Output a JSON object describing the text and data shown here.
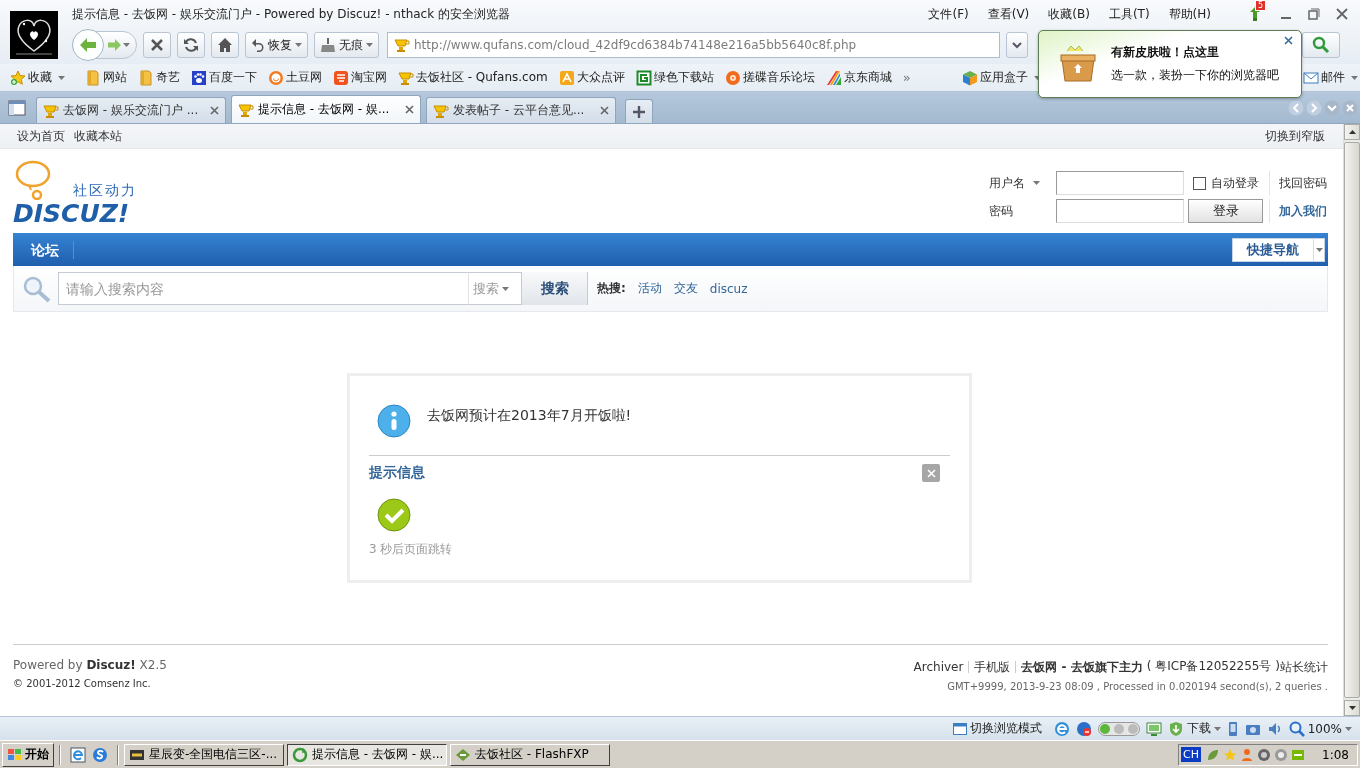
{
  "window": {
    "title": "提示信息 - 去饭网 - 娱乐交流门户 - Powered by Discuz! - nthack 的安全浏览器"
  },
  "menu": [
    "文件(F)",
    "查看(V)",
    "收藏(B)",
    "工具(T)",
    "帮助(H)"
  ],
  "notification_badge": "5",
  "toolbar": {
    "restore": "恢复",
    "private": "无痕"
  },
  "address_bar": {
    "url": "http://www.qufans.com/cloud_42df9cd6384b74148e216a5bb5640c8f.php"
  },
  "bookmarks": [
    {
      "label": "收藏",
      "kind": "star"
    },
    {
      "label": "网站",
      "kind": "folder"
    },
    {
      "label": "奇艺",
      "kind": "folder"
    },
    {
      "label": "百度一下",
      "kind": "paw"
    },
    {
      "label": "土豆网",
      "kind": "face"
    },
    {
      "label": "淘宝网",
      "kind": "tao"
    },
    {
      "label": "去饭社区 - Qufans.com",
      "kind": "cup"
    },
    {
      "label": "大众点评",
      "kind": "review"
    },
    {
      "label": "绿色下载站",
      "kind": "gbox"
    },
    {
      "label": "搓碟音乐论坛",
      "kind": "disc"
    },
    {
      "label": "京东商城",
      "kind": "rainbow"
    },
    {
      "label": "»",
      "kind": "more"
    },
    {
      "label": "应用盒子",
      "kind": "cube"
    },
    {
      "label": "邮件",
      "kind": "mail"
    }
  ],
  "tabs": [
    {
      "title": "去饭网 - 娱乐交流门户 ...",
      "selected": false
    },
    {
      "title": "提示信息 - 去饭网 - 娱...",
      "selected": true
    },
    {
      "title": "发表帖子 - 云平台意见...",
      "selected": false
    }
  ],
  "popup": {
    "title": "有新皮肤啦！点这里",
    "text": "选一款，装扮一下你的浏览器吧"
  },
  "site_topbar": {
    "links": [
      "设为首页",
      "收藏本站"
    ],
    "switch_width": "切换到窄版"
  },
  "logo": {
    "tagline": "社区动力",
    "wordmark": "DISCUZ!"
  },
  "login": {
    "username_label": "用户名",
    "password_label": "密码",
    "auto_login": {
      "label": "自动登录",
      "checked": false
    },
    "button": "登录",
    "forgot": "找回密码",
    "register": "加入我们"
  },
  "nav": {
    "items": [
      "论坛"
    ],
    "quick_nav": "快捷导航"
  },
  "search": {
    "placeholder": "请输入搜索内容",
    "scope": "搜索",
    "button": "搜索",
    "hot_label": "热搜:",
    "hot": [
      "活动",
      "交友",
      "discuz"
    ]
  },
  "message": {
    "text": "去饭网预计在2013年7月开饭啦!",
    "title": "提示信息",
    "redirect": "3 秒后页面跳转"
  },
  "footer": {
    "powered": "Powered by **Discuz!** X2.5",
    "copyright": "© 2001-2012 Comsenz Inc.",
    "links": [
      "Archiver",
      "手机版"
    ],
    "site": "去饭网 - 去饭旗下主力",
    "icp": "( 粤ICP备12052255号 )",
    "stats": "站长统计",
    "debug": "GMT+9999, 2013-9-23 08:09 , Processed in 0.020194 second(s), 2 queries ."
  },
  "status_bar": {
    "mode": "切换浏览模式",
    "download": "下载",
    "zoom": "100%"
  },
  "taskbar": {
    "start": "开始",
    "items": [
      {
        "label": "星辰变-全国电信三区-...",
        "selected": false
      },
      {
        "label": "提示信息 - 去饭网 - 娱...",
        "selected": true
      },
      {
        "label": "去饭社区 - FlashFXP",
        "selected": false
      }
    ],
    "ime": "CH",
    "clock": "1:08"
  }
}
